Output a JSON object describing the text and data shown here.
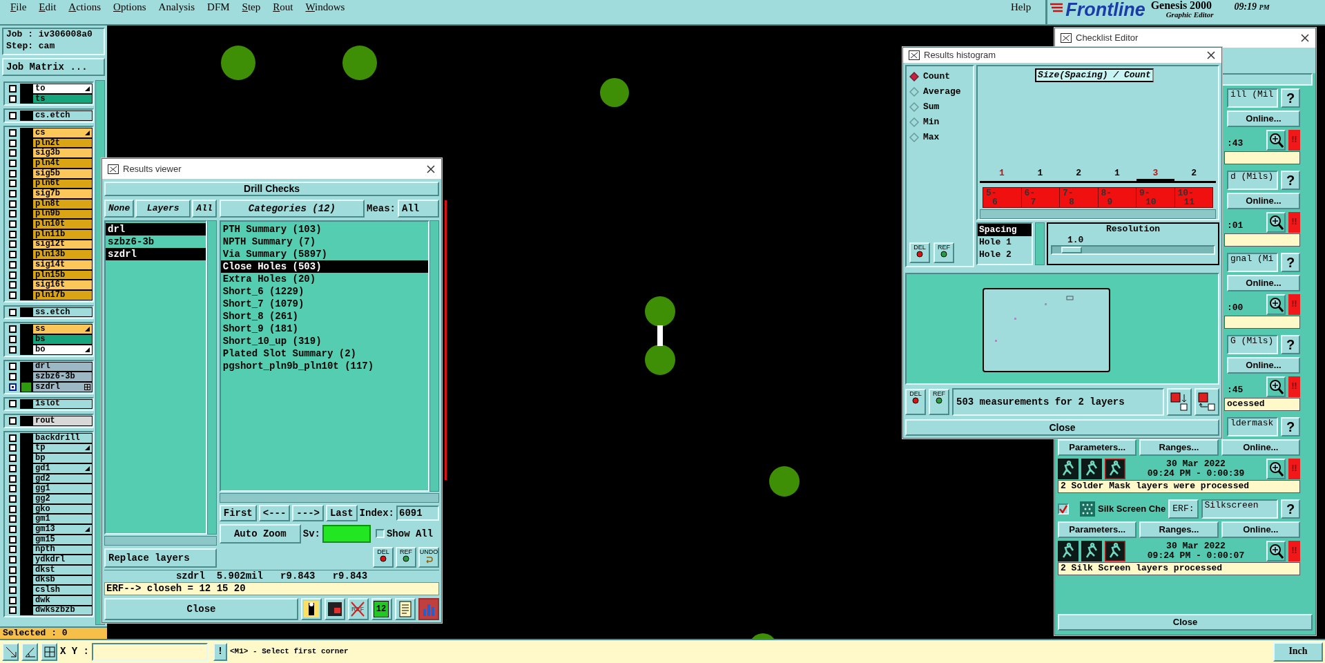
{
  "menu_bar": {
    "items": [
      {
        "label": "File",
        "mnemonic": true
      },
      {
        "label": "Edit",
        "mnemonic": true
      },
      {
        "label": "Actions",
        "mnemonic": true
      },
      {
        "label": "Options",
        "mnemonic": true
      },
      {
        "label": "Analysis",
        "mnemonic": false
      },
      {
        "label": "DFM",
        "mnemonic": false
      },
      {
        "label": "Step",
        "mnemonic": true
      },
      {
        "label": "Rout",
        "mnemonic": true
      },
      {
        "label": "Windows",
        "mnemonic": true
      }
    ],
    "help": "Help",
    "logo": {
      "brand": "Frontline",
      "product": "Genesis 2000",
      "subtitle": "Graphic Editor"
    },
    "clock": {
      "time": "09:19",
      "suffix": "PM"
    }
  },
  "job_panel": {
    "job": "Job : iv306008a0",
    "step": "Step: cam",
    "matrix_button": "Job Matrix ...",
    "selected_count": "Selected : 0",
    "layer_groups": [
      {
        "layers": [
          {
            "name": "to",
            "color": "#ffffff",
            "selected": false,
            "flag": true
          },
          {
            "name": "ts",
            "color": "#17a57e",
            "selected": false,
            "flag": false
          }
        ]
      },
      {
        "layers": [
          {
            "name": "cs.etch",
            "color": "#a0dcdc",
            "selected": false,
            "flag": false
          }
        ]
      },
      {
        "layers": [
          {
            "name": "cs",
            "color": "#fbc75a",
            "selected": false,
            "flag": true
          },
          {
            "name": "pln2t",
            "color": "#d9a514",
            "selected": false,
            "flag": false
          },
          {
            "name": "sig3b",
            "color": "#fbc75a",
            "selected": false,
            "flag": false
          },
          {
            "name": "pln4t",
            "color": "#d9a514",
            "selected": false,
            "flag": false
          },
          {
            "name": "sig5b",
            "color": "#fbc75a",
            "selected": false,
            "flag": false
          },
          {
            "name": "pln6t",
            "color": "#d9a514",
            "selected": false,
            "flag": false
          },
          {
            "name": "sig7b",
            "color": "#fbc75a",
            "selected": false,
            "flag": false
          },
          {
            "name": "pln8t",
            "color": "#d9a514",
            "selected": false,
            "flag": false
          },
          {
            "name": "pln9b",
            "color": "#d9a514",
            "selected": false,
            "flag": false
          },
          {
            "name": "pln10t",
            "color": "#d9a514",
            "selected": false,
            "flag": false
          },
          {
            "name": "pln11b",
            "color": "#d9a514",
            "selected": false,
            "flag": false
          },
          {
            "name": "sig12t",
            "color": "#fbc75a",
            "selected": false,
            "flag": false
          },
          {
            "name": "pln13b",
            "color": "#d9a514",
            "selected": false,
            "flag": false
          },
          {
            "name": "sig14t",
            "color": "#fbc75a",
            "selected": false,
            "flag": false
          },
          {
            "name": "pln15b",
            "color": "#d9a514",
            "selected": false,
            "flag": false
          },
          {
            "name": "sig16t",
            "color": "#fbc75a",
            "selected": false,
            "flag": false
          },
          {
            "name": "pln17b",
            "color": "#d9a514",
            "selected": false,
            "flag": false
          }
        ]
      },
      {
        "layers": [
          {
            "name": "ss.etch",
            "color": "#a0dcdc",
            "selected": false,
            "flag": false
          }
        ]
      },
      {
        "layers": [
          {
            "name": "ss",
            "color": "#fbc75a",
            "selected": false,
            "flag": true
          },
          {
            "name": "bs",
            "color": "#17a57e",
            "selected": false,
            "flag": false
          },
          {
            "name": "bo",
            "color": "#ffffff",
            "selected": false,
            "flag": true
          }
        ]
      },
      {
        "layers": [
          {
            "name": "drl",
            "color": "#9cb8c4",
            "selected": false,
            "flag": false
          },
          {
            "name": "szbz6-3b",
            "color": "#9cb8c4",
            "selected": false,
            "flag": false
          },
          {
            "name": "szdrl",
            "color": "#9cb8c4",
            "selected": true,
            "flag": false
          }
        ]
      },
      {
        "layers": [
          {
            "name": "1slot",
            "color": "#a0dcdc",
            "selected": false,
            "flag": false
          }
        ]
      },
      {
        "layers": [
          {
            "name": "rout",
            "color": "#d8d8d8",
            "selected": false,
            "flag": false
          }
        ]
      },
      {
        "layers": [
          {
            "name": "backdrill",
            "color": "#a0dcdc",
            "selected": false,
            "flag": false
          },
          {
            "name": "tp",
            "color": "#a0dcdc",
            "selected": false,
            "flag": true
          },
          {
            "name": "bp",
            "color": "#a0dcdc",
            "selected": false,
            "flag": false
          },
          {
            "name": "gd1",
            "color": "#a0dcdc",
            "selected": false,
            "flag": true
          },
          {
            "name": "gd2",
            "color": "#a0dcdc",
            "selected": false,
            "flag": false
          },
          {
            "name": "gg1",
            "color": "#a0dcdc",
            "selected": false,
            "flag": false
          },
          {
            "name": "gg2",
            "color": "#a0dcdc",
            "selected": false,
            "flag": false
          },
          {
            "name": "gko",
            "color": "#a0dcdc",
            "selected": false,
            "flag": false
          },
          {
            "name": "gm1",
            "color": "#a0dcdc",
            "selected": false,
            "flag": false
          },
          {
            "name": "gm13",
            "color": "#a0dcdc",
            "selected": false,
            "flag": true
          },
          {
            "name": "gm15",
            "color": "#a0dcdc",
            "selected": false,
            "flag": false
          },
          {
            "name": "npth",
            "color": "#a0dcdc",
            "selected": false,
            "flag": false
          },
          {
            "name": "ydkdrl",
            "color": "#a0dcdc",
            "selected": false,
            "flag": false
          },
          {
            "name": "dkst",
            "color": "#a0dcdc",
            "selected": false,
            "flag": false
          },
          {
            "name": "dksb",
            "color": "#a0dcdc",
            "selected": false,
            "flag": false
          },
          {
            "name": "cslsh",
            "color": "#a0dcdc",
            "selected": false,
            "flag": false
          },
          {
            "name": "dwk",
            "color": "#a0dcdc",
            "selected": false,
            "flag": false
          },
          {
            "name": "dwkszbzb",
            "color": "#a0dcdc",
            "selected": false,
            "flag": false
          }
        ]
      }
    ]
  },
  "results_viewer": {
    "title": "Results viewer",
    "header": "Drill Checks",
    "layer_buttons": [
      "None",
      "Layers",
      "All"
    ],
    "layers": [
      {
        "name": "drl",
        "selected": true
      },
      {
        "name": "szbz6-3b",
        "selected": false
      },
      {
        "name": "szdrl",
        "selected": true
      }
    ],
    "replace_menu": "Replace layers",
    "categories_button": "Categories (12)",
    "meas_label": "Meas:",
    "meas_value": "All",
    "categories": [
      {
        "label": "PTH Summary (103)",
        "selected": false
      },
      {
        "label": "NPTH Summary (7)",
        "selected": false
      },
      {
        "label": "Via Summary (5897)",
        "selected": false
      },
      {
        "label": "Close Holes (503)",
        "selected": true
      },
      {
        "label": "Extra Holes (20)",
        "selected": false
      },
      {
        "label": "Short_6 (1229)",
        "selected": false
      },
      {
        "label": "Short_7 (1079)",
        "selected": false
      },
      {
        "label": "Short_8 (261)",
        "selected": false
      },
      {
        "label": "Short_9 (181)",
        "selected": false
      },
      {
        "label": "Short_10_up (319)",
        "selected": false
      },
      {
        "label": "Plated Slot Summary (2)",
        "selected": false
      },
      {
        "label": "pgshort_pln9b_pln10t (117)",
        "selected": false
      }
    ],
    "nav_buttons": [
      "First",
      "<---",
      "--->",
      "Last"
    ],
    "index_label": "Index:",
    "index_value": "6091",
    "zoom_menu": "Auto Zoom",
    "sv_label": "Sv:",
    "show_all": {
      "label": "Show All",
      "checked": false
    },
    "tool_buttons": [
      {
        "kind": "del",
        "text": "DEL"
      },
      {
        "kind": "ref",
        "text": "REF"
      },
      {
        "kind": "undo",
        "text": "UNDO"
      }
    ],
    "measurement": "szdrl  5.902mil   r9.843   r9.843",
    "erf_line": "ERF--> closeh = 12 15 20",
    "close": "Close",
    "toolbar": [
      {
        "kind": "figure",
        "selected": false
      },
      {
        "kind": "layer",
        "selected": false
      },
      {
        "kind": "ref_off",
        "text": "REF",
        "selected": false
      },
      {
        "kind": "number",
        "text": "12",
        "selected": false
      },
      {
        "kind": "report",
        "selected": false
      },
      {
        "kind": "histogram",
        "selected": true
      }
    ]
  },
  "histogram": {
    "title": "Results histogram",
    "modes": [
      {
        "label": "Count",
        "selected": true
      },
      {
        "label": "Average",
        "selected": false
      },
      {
        "label": "Sum",
        "selected": false
      },
      {
        "label": "Min",
        "selected": false
      },
      {
        "label": "Max",
        "selected": false
      }
    ],
    "side_buttons": [
      {
        "kind": "del",
        "text": "DEL"
      },
      {
        "kind": "ref",
        "text": "REF"
      }
    ],
    "chart_title": "Size(Spacing) / Count",
    "bins": [
      {
        "count": "1",
        "from": "5-",
        "to": "6",
        "marked": true,
        "current": false
      },
      {
        "count": "1",
        "from": "6-",
        "to": "7",
        "marked": false,
        "current": false
      },
      {
        "count": "2",
        "from": "7-",
        "to": "8",
        "marked": false,
        "current": false
      },
      {
        "count": "1",
        "from": "8-",
        "to": "9",
        "marked": false,
        "current": false
      },
      {
        "count": "3",
        "from": "9-",
        "to": "10",
        "marked": true,
        "current": true
      },
      {
        "count": "2",
        "from": "10-",
        "to": "11",
        "marked": false,
        "current": false
      }
    ],
    "columns": [
      {
        "label": "Spacing",
        "selected": true
      },
      {
        "label": "Hole 1",
        "selected": false
      },
      {
        "label": "Hole 2",
        "selected": false
      }
    ],
    "resolution": {
      "title": "Resolution",
      "value": "1.0",
      "level": 0.12
    },
    "bottom_buttons": [
      {
        "kind": "del",
        "text": "DEL"
      },
      {
        "kind": "ref",
        "text": "REF"
      }
    ],
    "summary": "503 measurements for 2 layers",
    "close": "Close"
  },
  "checklist_editor": {
    "title": "Checklist Editor",
    "close": "Close",
    "checks": [
      {
        "kind": "covered",
        "erf_value": "ill (Mil",
        "help": "?",
        "online": "Online...",
        "time": ":43",
        "alert": "!!"
      },
      {
        "kind": "covered",
        "erf_value": "d (Mils)",
        "help": "?",
        "online": "Online...",
        "time": ":01",
        "alert": "!!"
      },
      {
        "kind": "covered",
        "erf_value": "gnal (Mi",
        "help": "?",
        "online": "Online...",
        "time": ":00",
        "alert": "!!"
      },
      {
        "kind": "covered",
        "erf_value": "G (Mils)",
        "help": "?",
        "online": "Online...",
        "time": ":45",
        "alert": "!!",
        "message": "ocessed"
      },
      {
        "kind": "partial",
        "erf_value": "ldermask",
        "help": "?",
        "buttons": [
          "Parameters...",
          "Ranges...",
          "Online..."
        ],
        "date": "30 Mar 2022",
        "time": "09:24 PM - 0:00:39",
        "alert": "!!",
        "message": "2 Solder Mask layers were processed"
      },
      {
        "kind": "full",
        "checked": true,
        "name": "Silk Screen Che",
        "erf_label": "ERF:",
        "erf_value": "Silkscreen",
        "help": "?",
        "buttons": [
          "Parameters...",
          "Ranges...",
          "Online..."
        ],
        "date": "30 Mar 2022",
        "time": "09:24 PM - 0:00:07",
        "alert": "!!",
        "message": "2 Silk Screen layers processed"
      }
    ]
  },
  "status_bar": {
    "xy_label": "X Y :",
    "alert_button": "!",
    "hint": "<M1> - Select first corner",
    "units": "Inch"
  }
}
